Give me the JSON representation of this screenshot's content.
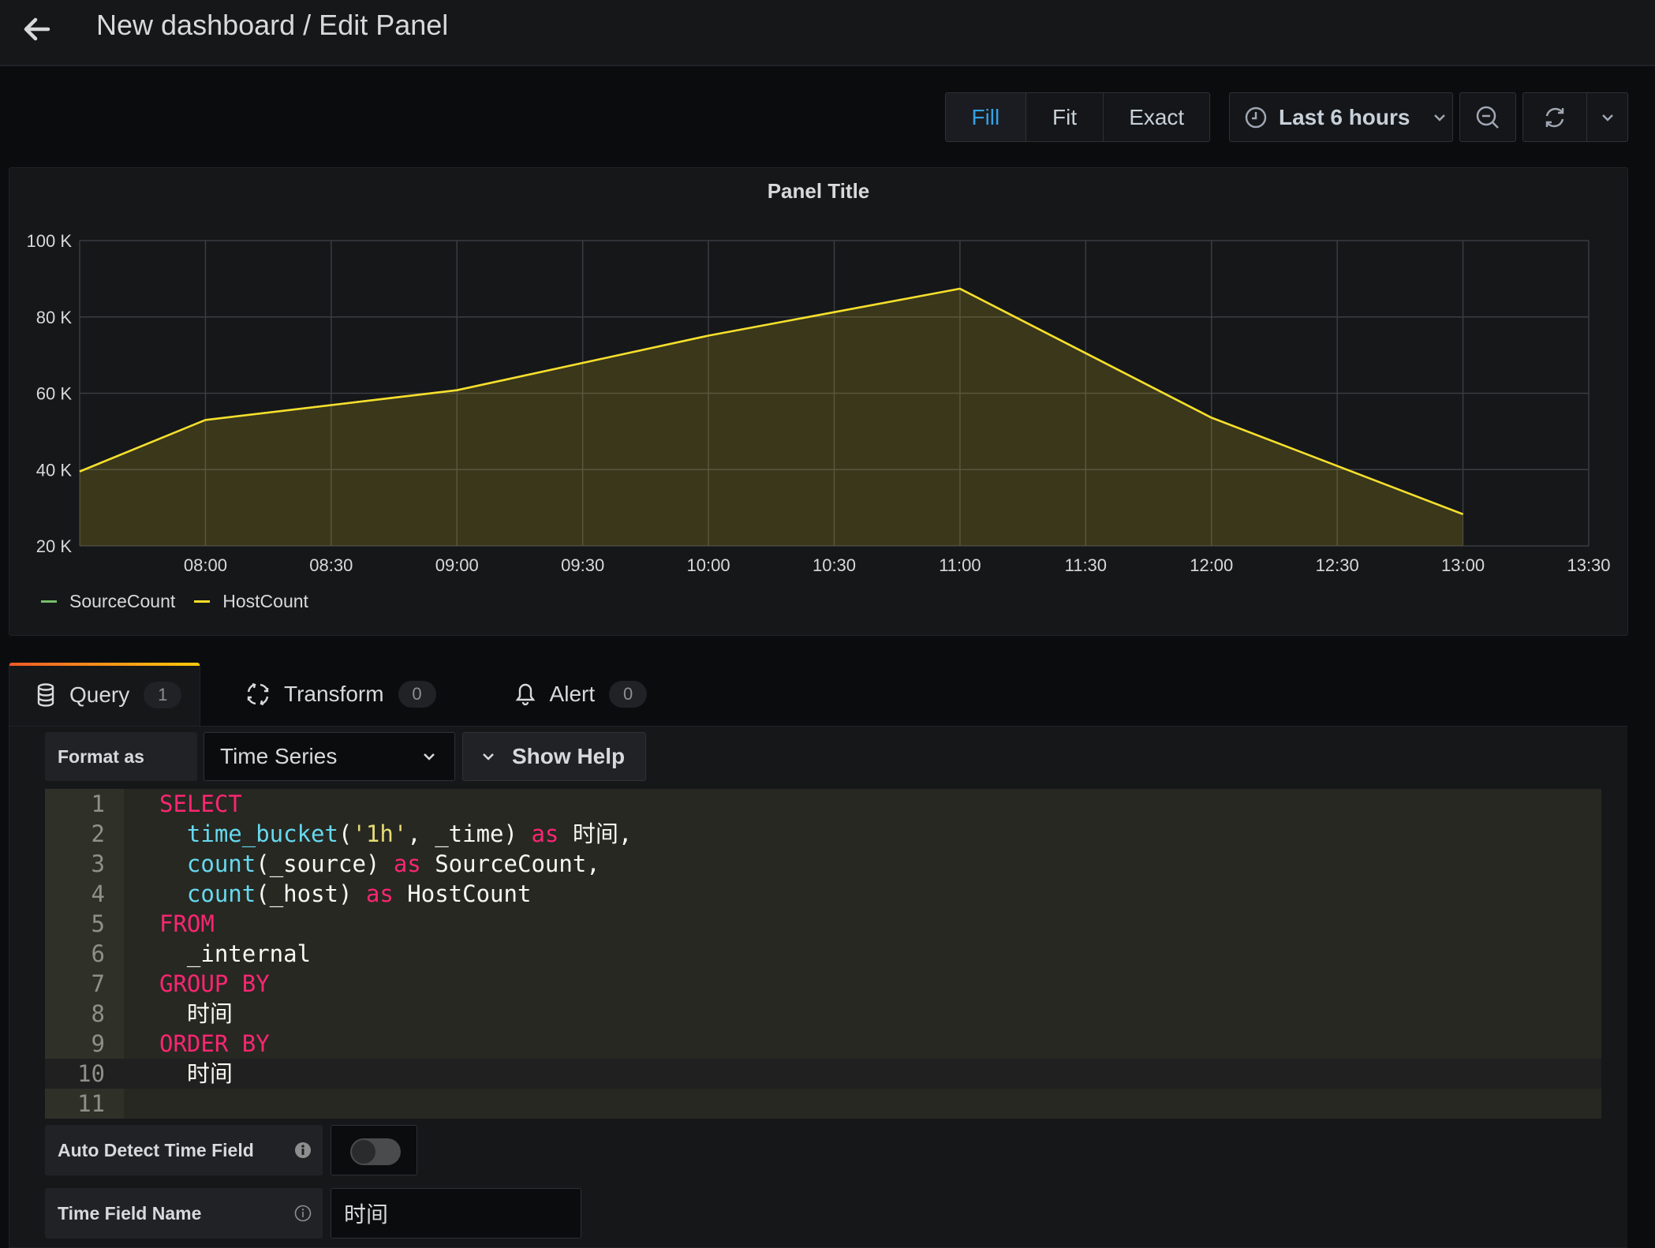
{
  "header": {
    "title": "New dashboard / Edit Panel",
    "back_icon": "arrow-left-icon"
  },
  "toolbar": {
    "view_modes": [
      {
        "label": "Fill",
        "active": true
      },
      {
        "label": "Fit",
        "active": false
      },
      {
        "label": "Exact",
        "active": false
      }
    ],
    "time_range": "Last 6 hours",
    "time_icon": "clock-icon",
    "zoom_icon": "zoom-out-icon",
    "refresh_icon": "refresh-icon"
  },
  "panel": {
    "title": "Panel Title",
    "legend": [
      {
        "label": "SourceCount",
        "color": "#73bf69"
      },
      {
        "label": "HostCount",
        "color": "#fade2a"
      }
    ]
  },
  "chart_data": {
    "type": "area",
    "title": "Panel Title",
    "x": [
      "07:30",
      "08:00",
      "09:00",
      "10:00",
      "11:00",
      "12:00",
      "13:00"
    ],
    "x_ticks": [
      "08:00",
      "08:30",
      "09:00",
      "09:30",
      "10:00",
      "10:30",
      "11:00",
      "11:30",
      "12:00",
      "12:30",
      "13:00",
      "13:30"
    ],
    "y_ticks": [
      "20 K",
      "40 K",
      "60 K",
      "80 K",
      "100 K"
    ],
    "ylim": [
      20000,
      100000
    ],
    "xlim": [
      "07:30",
      "13:30"
    ],
    "grid": true,
    "legend_position": "bottom-left",
    "series": [
      {
        "name": "SourceCount",
        "color": "#73bf69",
        "values": [
          39500,
          53000,
          60800,
          75100,
          87400,
          53600,
          28300
        ]
      },
      {
        "name": "HostCount",
        "color": "#fade2a",
        "values": [
          39500,
          53000,
          60800,
          75100,
          87400,
          53600,
          28300
        ]
      }
    ],
    "xlabel": "",
    "ylabel": ""
  },
  "tabs": [
    {
      "label": "Query",
      "count": "1",
      "icon": "database-icon",
      "active": true
    },
    {
      "label": "Transform",
      "count": "0",
      "icon": "transform-icon",
      "active": false
    },
    {
      "label": "Alert",
      "count": "0",
      "icon": "bell-icon",
      "active": false
    }
  ],
  "query": {
    "format_label": "Format as",
    "format_value": "Time Series",
    "show_help": "Show Help",
    "code_lines": [
      [
        {
          "t": "SELECT",
          "c": "kw"
        }
      ],
      [
        {
          "t": "  "
        },
        {
          "t": "time_bucket",
          "c": "fn"
        },
        {
          "t": "("
        },
        {
          "t": "'1h'",
          "c": "str"
        },
        {
          "t": ", _time) "
        },
        {
          "t": "as",
          "c": "kw"
        },
        {
          "t": " 时间,"
        }
      ],
      [
        {
          "t": "  "
        },
        {
          "t": "count",
          "c": "fn"
        },
        {
          "t": "(_source) "
        },
        {
          "t": "as",
          "c": "kw"
        },
        {
          "t": " SourceCount,"
        }
      ],
      [
        {
          "t": "  "
        },
        {
          "t": "count",
          "c": "fn"
        },
        {
          "t": "(_host) "
        },
        {
          "t": "as",
          "c": "kw"
        },
        {
          "t": " HostCount"
        }
      ],
      [
        {
          "t": "FROM",
          "c": "kw"
        }
      ],
      [
        {
          "t": "  _internal"
        }
      ],
      [
        {
          "t": "GROUP BY",
          "c": "kw"
        }
      ],
      [
        {
          "t": "  时间"
        }
      ],
      [
        {
          "t": "ORDER BY",
          "c": "kw"
        }
      ],
      [
        {
          "t": "  时间"
        }
      ],
      []
    ],
    "current_line": 10,
    "auto_detect_label": "Auto Detect Time Field",
    "auto_detect_enabled": false,
    "time_field_label": "Time Field Name",
    "time_field_value": "时间"
  }
}
